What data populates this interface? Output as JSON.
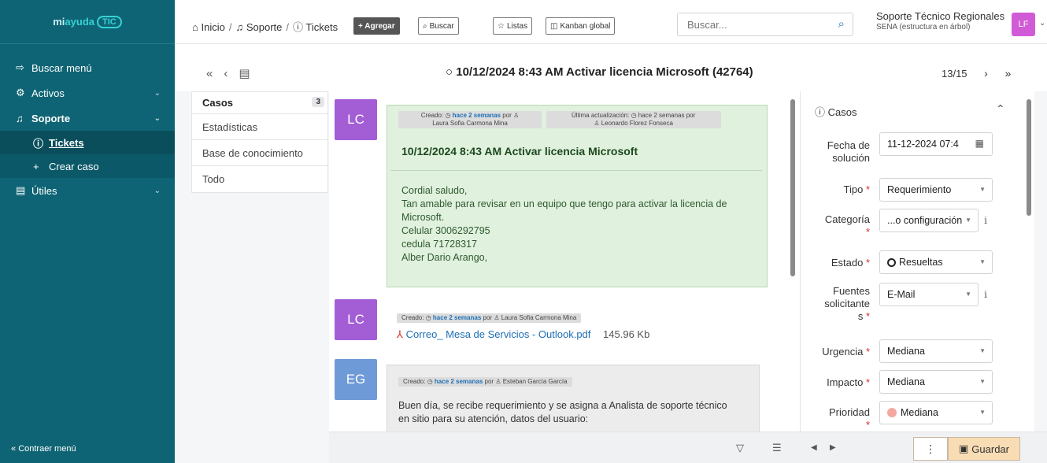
{
  "sidebar": {
    "logo": {
      "part1": "mi",
      "part2": "ayuda",
      "part3": "TIC"
    },
    "items": [
      {
        "label": "Buscar menú",
        "icon": "login-arrow-icon"
      },
      {
        "label": "Activos",
        "icon": "gear-icon"
      },
      {
        "label": "Soporte",
        "icon": "headset-icon"
      },
      {
        "label": "Tickets",
        "icon": "alert-circle-icon"
      },
      {
        "label": "Crear caso",
        "icon": "plus-icon"
      },
      {
        "label": "Útiles",
        "icon": "briefcase-icon"
      }
    ],
    "collapse_label": "Contraer menú"
  },
  "topbar": {
    "breadcrumbs": [
      "Inicio",
      "Soporte",
      "Tickets"
    ],
    "buttons": {
      "add": "+ Agregar",
      "search": "Buscar",
      "lists": "Listas",
      "kanban": "Kanban global"
    },
    "search_placeholder": "Buscar...",
    "user_name": "Soporte Técnico Regionales",
    "user_org": "SENA (estructura en árbol)",
    "avatar_initials": "LF"
  },
  "ticket": {
    "title": "10/12/2024 8:43 AM Activar licencia Microsoft (42764)",
    "pager": "13/15"
  },
  "tabs": [
    {
      "label": "Casos",
      "badge": "3"
    },
    {
      "label": "Estadísticas"
    },
    {
      "label": "Base de conocimiento"
    },
    {
      "label": "Todo"
    }
  ],
  "timeline": [
    {
      "initials": "LC",
      "avatar_color": "#a35ed6",
      "created_prefix": "Creado:",
      "created_when": "hace 2 semanas",
      "created_by_prefix": "por",
      "created_by": "Laura Sofia Carmona Mina",
      "updated_prefix": "Última actualización:",
      "updated_when": "hace 2 semanas",
      "updated_by_prefix": "por",
      "updated_by": "Leonardo Florez Fonseca",
      "title": "10/12/2024 8:43 AM Activar licencia Microsoft",
      "body": [
        "Cordial saludo,",
        "Tan amable para revisar en un equipo que tengo para activar la licencia de",
        "Microsoft.",
        "Celular 3006292795",
        "cedula 71728317",
        "Alber Dario Arango,"
      ]
    },
    {
      "initials": "LC",
      "avatar_color": "#a35ed6",
      "created_prefix": "Creado:",
      "created_when": "hace 2 semanas",
      "created_by_prefix": "por",
      "created_by": "Laura Sofia Carmona Mina",
      "file_name": "Correo_ Mesa de Servicios - Outlook.pdf",
      "file_size": "145.96 Kb"
    },
    {
      "initials": "EG",
      "avatar_color": "#6e9ad8",
      "created_prefix": "Creado:",
      "created_when": "hace 2 semanas",
      "created_by_prefix": "por",
      "created_by": "Esteban García García",
      "body": [
        "Buen día, se recibe requerimiento y se asigna a Analista de soporte técnico",
        "en sitio para su atención, datos del usuario:"
      ]
    }
  ],
  "panel": {
    "header": "Casos",
    "fields": {
      "fecha_label_1": "Fecha de",
      "fecha_label_2": "solución",
      "fecha_value": "11-12-2024 07:4",
      "tipo_label": "Tipo",
      "tipo_value": "Requerimiento",
      "categoria_label": "Categoría",
      "categoria_value": "...o configuración",
      "estado_label": "Estado",
      "estado_value": "Resueltas",
      "fuentes_label_1": "Fuentes",
      "fuentes_label_2": "solicitante",
      "fuentes_label_3": "s",
      "fuentes_value": "E-Mail",
      "urgencia_label": "Urgencia",
      "urgencia_value": "Mediana",
      "impacto_label": "Impacto",
      "impacto_value": "Mediana",
      "prioridad_label": "Prioridad",
      "prioridad_value": "Mediana"
    },
    "required_mark": "*"
  },
  "bottombar": {
    "save_label": "Guardar"
  }
}
